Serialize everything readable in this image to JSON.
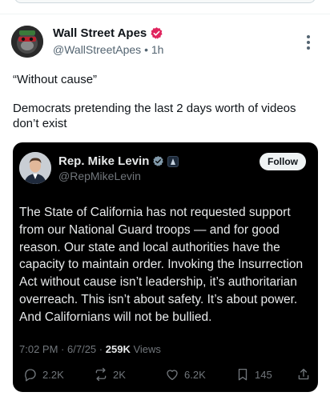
{
  "post": {
    "author_name": "Wall Street Apes",
    "handle": "@WallStreetApes",
    "time": "1h",
    "separator": "•",
    "text_line1": "“Without cause”",
    "text_line2": "Democrats pretending the last 2 days worth of videos don’t exist"
  },
  "quote": {
    "author_name": "Rep. Mike Levin",
    "handle": "@RepMikeLevin",
    "follow_label": "Follow",
    "body": "The State of California has not requested support from our National Guard troops — and for good reason. Our state and local authorities have the capacity to maintain order. Invoking the Insurrection Act without cause isn’t leadership, it’s authoritarian overreach. This isn’t about safety. It’s about power. And Californians will not be bullied.",
    "time": "7:02 PM",
    "date": "6/7/25",
    "meta_sep": "·",
    "views_count": "259K",
    "views_label": "Views",
    "replies": "2.2K",
    "reposts": "2K",
    "likes": "6.2K",
    "bookmarks": "145"
  },
  "colors": {
    "verified_badge": "#e0245e",
    "check_gray": "#829aab",
    "quote_bg": "#000000",
    "secondary_text": "#536471"
  },
  "icons": [
    "verified-badge-icon",
    "more-options-icon",
    "reply-icon",
    "repost-icon",
    "like-icon",
    "bookmark-icon",
    "share-icon",
    "government-flag-icon"
  ]
}
